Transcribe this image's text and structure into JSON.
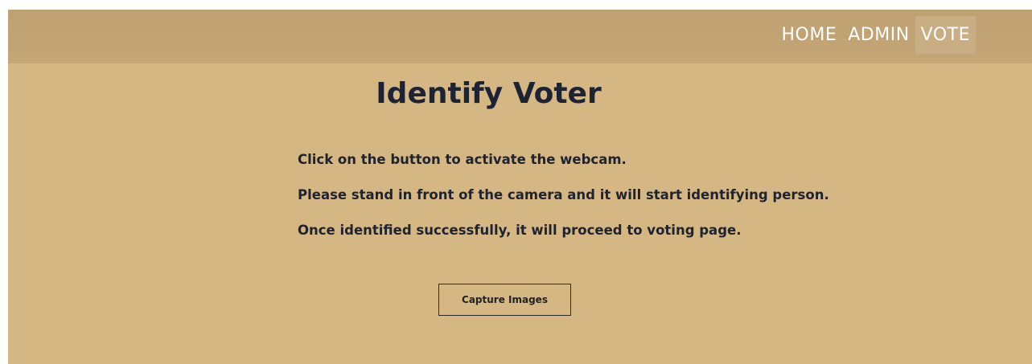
{
  "nav": {
    "items": [
      {
        "label": "HOME",
        "active": false
      },
      {
        "label": "ADMIN",
        "active": false
      },
      {
        "label": "VOTE",
        "active": true
      }
    ]
  },
  "main": {
    "title": "Identify Voter",
    "instructions": [
      "Click on the button to activate the webcam.",
      "Please stand in front of the camera and it will start identifying person.",
      "Once identified successfully, it will proceed to voting page."
    ],
    "capture_button_label": "Capture Images"
  },
  "colors": {
    "background": "#d4b783",
    "navbar": "#c2a474",
    "active_nav": "#c9ae83",
    "title_text": "#1c2334"
  }
}
